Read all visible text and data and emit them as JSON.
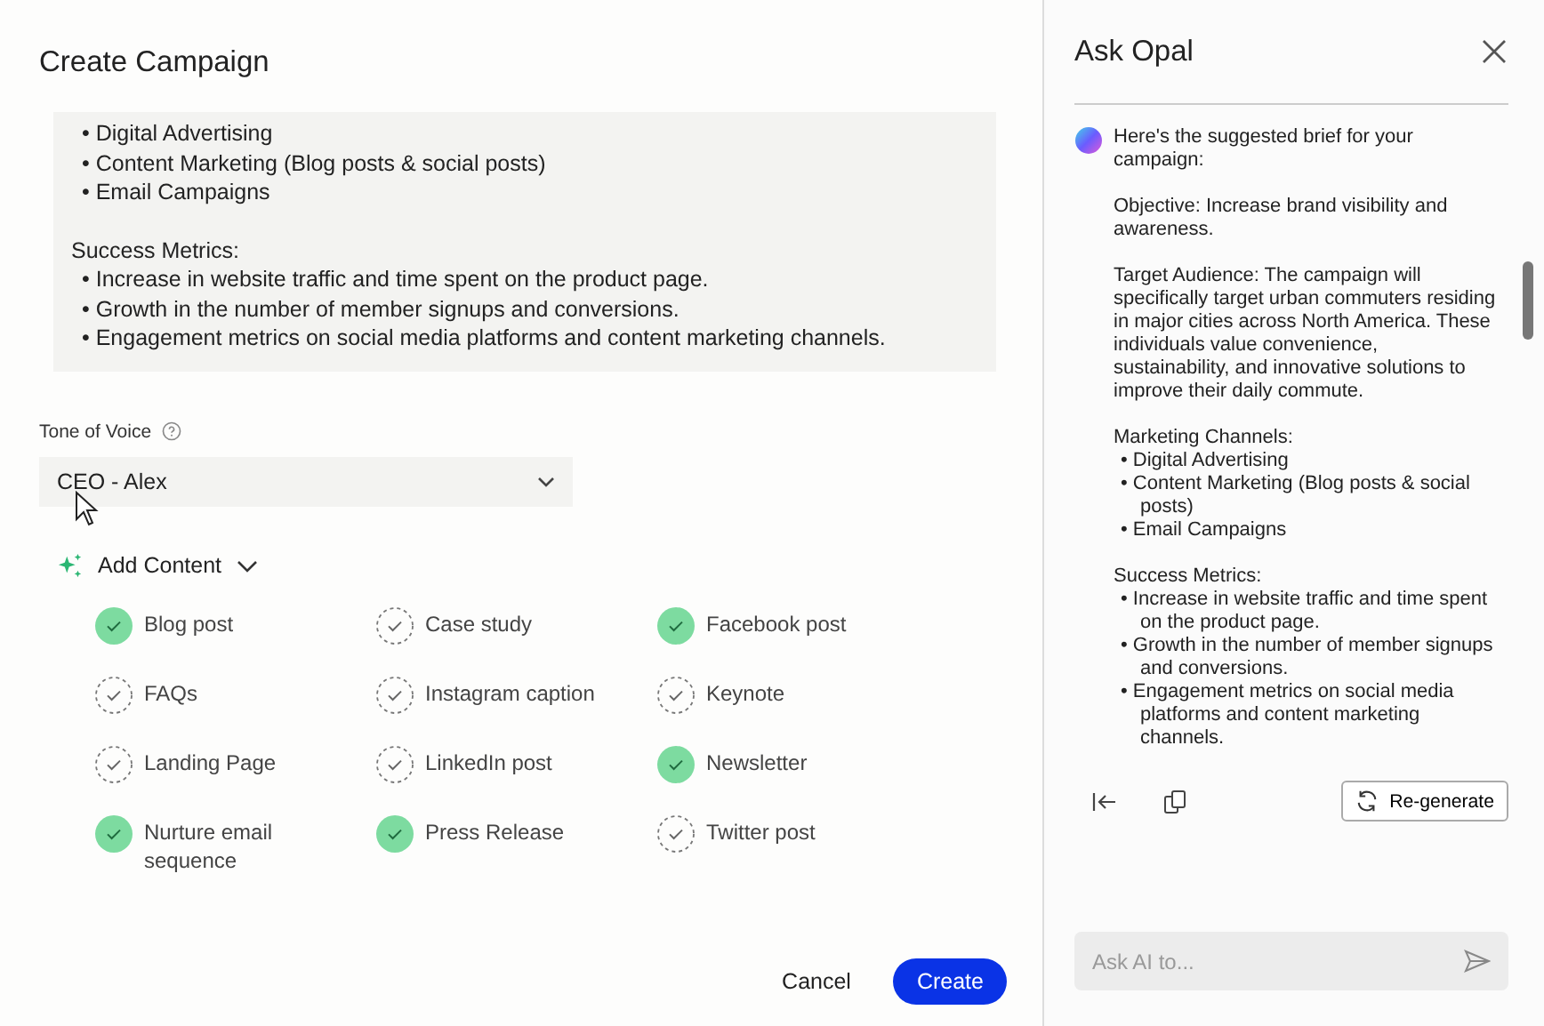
{
  "dialog": {
    "title": "Create Campaign",
    "brief": {
      "bullets_top": [
        "• Digital Advertising",
        "• Content Marketing (Blog posts & social posts)",
        "• Email Campaigns"
      ],
      "heading": "Success Metrics:",
      "bullets": [
        "• Increase in website traffic and time spent on the product page.",
        "• Growth in the number of member signups and conversions.",
        "• Engagement metrics on social media platforms and content marketing channels."
      ]
    },
    "tone": {
      "label": "Tone of Voice",
      "value": "CEO - Alex"
    },
    "add_content": {
      "label": "Add Content",
      "expanded": true,
      "items": [
        {
          "label": "Blog post",
          "checked": true
        },
        {
          "label": "Case study",
          "checked": false
        },
        {
          "label": "Facebook post",
          "checked": true
        },
        {
          "label": "FAQs",
          "checked": false
        },
        {
          "label": "Instagram caption",
          "checked": false
        },
        {
          "label": "Keynote",
          "checked": false
        },
        {
          "label": "Landing Page",
          "checked": false
        },
        {
          "label": "LinkedIn post",
          "checked": false
        },
        {
          "label": "Newsletter",
          "checked": true
        },
        {
          "label": "Nurture email sequence",
          "checked": true
        },
        {
          "label": "Press Release",
          "checked": true
        },
        {
          "label": "Twitter post",
          "checked": false
        }
      ]
    },
    "buttons": {
      "cancel": "Cancel",
      "create": "Create"
    }
  },
  "assistant": {
    "title": "Ask Opal",
    "message": {
      "intro": "Here's the suggested brief for your campaign:",
      "objective": "Objective: Increase brand visibility and awareness.",
      "audience": "Target Audience: The campaign will specifically target urban commuters residing in major cities across North America. These individuals value convenience, sustainability, and innovative solutions to improve their daily commute.",
      "sections": [
        {
          "heading": "Marketing Channels:",
          "bullets": [
            "• Digital Advertising",
            "• Content Marketing (Blog posts & social posts)",
            "• Email Campaigns"
          ]
        },
        {
          "heading": "Success Metrics:",
          "bullets": [
            "• Increase in website traffic and time spent on the product page.",
            "• Growth in the number of member signups and conversions.",
            "• Engagement metrics on social media platforms and content marketing channels."
          ]
        }
      ]
    },
    "regenerate": "Re-generate",
    "input": {
      "placeholder": "Ask AI to..."
    }
  }
}
